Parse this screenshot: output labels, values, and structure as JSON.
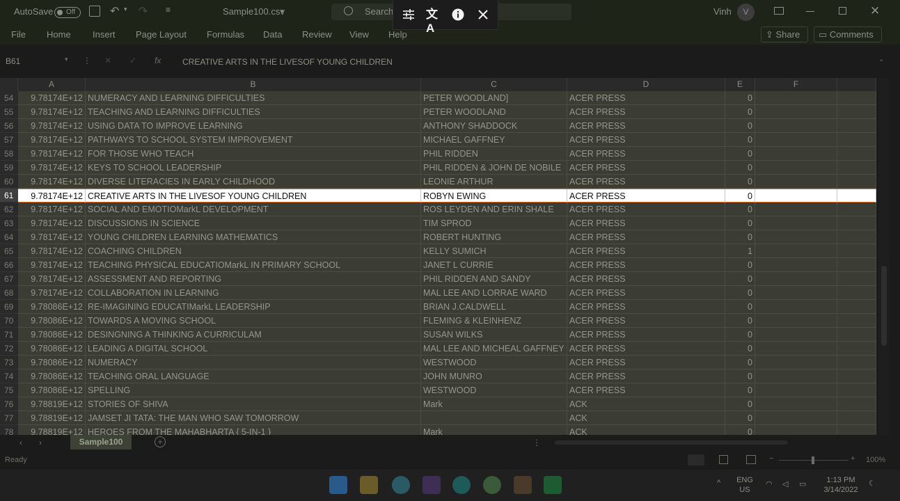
{
  "titlebar": {
    "autosave_label": "AutoSave",
    "autosave_state": "Off",
    "filename": "Sample100.csv",
    "search_placeholder": "Search",
    "user_name": "Vinh",
    "user_initial": "V"
  },
  "menu": {
    "items": [
      "File",
      "Home",
      "Insert",
      "Page Layout",
      "Formulas",
      "Data",
      "Review",
      "View",
      "Help"
    ],
    "share_label": "Share",
    "comments_label": "Comments"
  },
  "formula_bar": {
    "name_box": "B61",
    "fx": "fx",
    "content": "CREATIVE ARTS IN THE LIVESOF YOUNG CHILDREN"
  },
  "columns": [
    "A",
    "B",
    "C",
    "D",
    "E",
    "F"
  ],
  "rows": [
    {
      "n": "54",
      "a": "9.78174E+12",
      "b": "NUMERACY AND LEARNING DIFFICULTIES",
      "c": "PETER WOODLAND]",
      "d": "ACER PRESS",
      "e": "0"
    },
    {
      "n": "55",
      "a": "9.78174E+12",
      "b": "TEACHING AND LEARNING DIFFICULTIES",
      "c": "PETER WOODLAND",
      "d": "ACER PRESS",
      "e": "0"
    },
    {
      "n": "56",
      "a": "9.78174E+12",
      "b": "USING DATA TO IMPROVE LEARNING",
      "c": "ANTHONY SHADDOCK",
      "d": "ACER PRESS",
      "e": "0"
    },
    {
      "n": "57",
      "a": "9.78174E+12",
      "b": "PATHWAYS TO SCHOOL SYSTEM IMPROVEMENT",
      "c": "MICHAEL GAFFNEY",
      "d": "ACER PRESS",
      "e": "0"
    },
    {
      "n": "58",
      "a": "9.78174E+12",
      "b": "FOR THOSE WHO TEACH",
      "c": "PHIL RIDDEN",
      "d": "ACER PRESS",
      "e": "0"
    },
    {
      "n": "59",
      "a": "9.78174E+12",
      "b": "KEYS TO SCHOOL LEADERSHIP",
      "c": "PHIL RIDDEN & JOHN DE NOBILE",
      "d": "ACER PRESS",
      "e": "0"
    },
    {
      "n": "60",
      "a": "9.78174E+12",
      "b": "DIVERSE LITERACIES IN EARLY CHILDHOOD",
      "c": "LEONIE ARTHUR",
      "d": "ACER PRESS",
      "e": "0"
    },
    {
      "n": "61",
      "a": "9.78174E+12",
      "b": "CREATIVE ARTS IN THE LIVESOF YOUNG CHILDREN",
      "c": "ROBYN EWING",
      "d": "ACER PRESS",
      "e": "0"
    },
    {
      "n": "62",
      "a": "9.78174E+12",
      "b": "SOCIAL AND EMOTIOMarkL DEVELOPMENT",
      "c": "ROS LEYDEN AND ERIN SHALE",
      "d": "ACER PRESS",
      "e": "0"
    },
    {
      "n": "63",
      "a": "9.78174E+12",
      "b": "DISCUSSIONS IN SCIENCE",
      "c": "TIM SPROD",
      "d": "ACER PRESS",
      "e": "0"
    },
    {
      "n": "64",
      "a": "9.78174E+12",
      "b": "YOUNG CHILDREN LEARNING MATHEMATICS",
      "c": "ROBERT HUNTING",
      "d": "ACER PRESS",
      "e": "0"
    },
    {
      "n": "65",
      "a": "9.78174E+12",
      "b": "COACHING CHILDREN",
      "c": "KELLY SUMICH",
      "d": "ACER PRESS",
      "e": "1"
    },
    {
      "n": "66",
      "a": "9.78174E+12",
      "b": "TEACHING PHYSICAL EDUCATIOMarkL IN PRIMARY SCHOOL",
      "c": "JANET L CURRIE",
      "d": "ACER PRESS",
      "e": "0"
    },
    {
      "n": "67",
      "a": "9.78174E+12",
      "b": "ASSESSMENT AND REPORTING",
      "c": "PHIL RIDDEN AND SANDY",
      "d": "ACER PRESS",
      "e": "0"
    },
    {
      "n": "68",
      "a": "9.78174E+12",
      "b": "COLLABORATION IN LEARNING",
      "c": "MAL LEE AND LORRAE WARD",
      "d": "ACER PRESS",
      "e": "0"
    },
    {
      "n": "69",
      "a": "9.78086E+12",
      "b": "RE-IMAGINING EDUCATIMarkL LEADERSHIP",
      "c": "BRIAN J.CALDWELL",
      "d": "ACER PRESS",
      "e": "0"
    },
    {
      "n": "70",
      "a": "9.78086E+12",
      "b": "TOWARDS A MOVING SCHOOL",
      "c": "FLEMING & KLEINHENZ",
      "d": "ACER PRESS",
      "e": "0"
    },
    {
      "n": "71",
      "a": "9.78086E+12",
      "b": "DESINGNING A THINKING A CURRICULAM",
      "c": "SUSAN WILKS",
      "d": "ACER PRESS",
      "e": "0"
    },
    {
      "n": "72",
      "a": "9.78086E+12",
      "b": "LEADING A DIGITAL SCHOOL",
      "c": "MAL LEE AND MICHEAL GAFFNEY",
      "d": "ACER PRESS",
      "e": "0"
    },
    {
      "n": "73",
      "a": "9.78086E+12",
      "b": "NUMERACY",
      "c": "WESTWOOD",
      "d": "ACER PRESS",
      "e": "0"
    },
    {
      "n": "74",
      "a": "9.78086E+12",
      "b": "TEACHING ORAL LANGUAGE",
      "c": "JOHN MUNRO",
      "d": "ACER PRESS",
      "e": "0"
    },
    {
      "n": "75",
      "a": "9.78086E+12",
      "b": "SPELLING",
      "c": "WESTWOOD",
      "d": "ACER PRESS",
      "e": "0"
    },
    {
      "n": "76",
      "a": "9.78819E+12",
      "b": "STORIES OF SHIVA",
      "c": "Mark",
      "d": "ACK",
      "e": "0"
    },
    {
      "n": "77",
      "a": "9.78819E+12",
      "b": "JAMSET  JI TATA: THE MAN WHO SAW TOMORROW",
      "c": "",
      "d": "ACK",
      "e": "0"
    },
    {
      "n": "78",
      "a": "9.78819E+12",
      "b": "HEROES FROM THE MAHABHARTA { 5-IN-1 }",
      "c": "Mark",
      "d": "ACK",
      "e": "0"
    }
  ],
  "selected_row": "61",
  "sheet_tab": "Sample100",
  "status": {
    "ready": "Ready",
    "zoom": "100%"
  },
  "taskbar": {
    "lang_line1": "ENG",
    "lang_line2": "US",
    "time": "1:13 PM",
    "date": "3/14/2022"
  },
  "colors": {
    "selection_border": "#d96f1e",
    "sheet_tab_bg": "#3e4236",
    "dimmed_row_bg": "#3b3c33"
  }
}
